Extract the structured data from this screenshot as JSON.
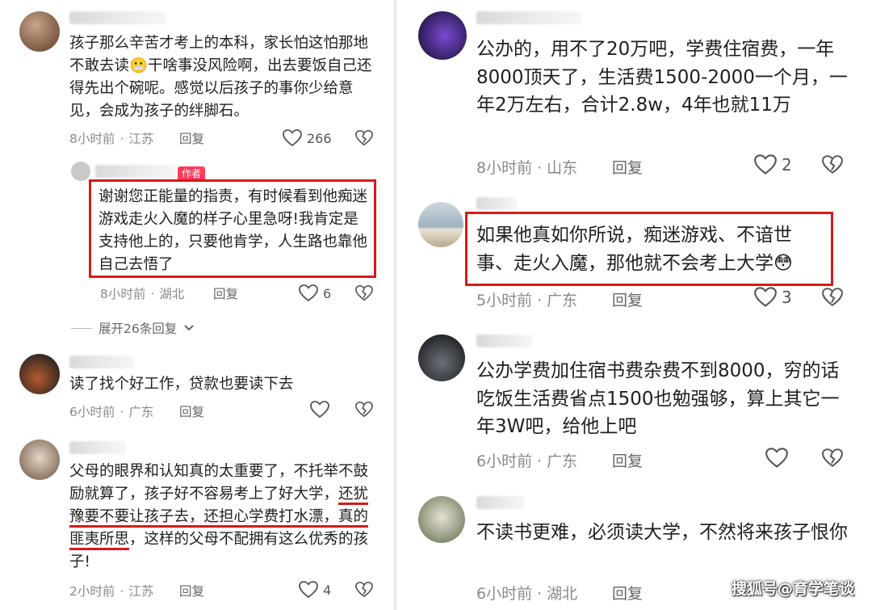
{
  "left": {
    "comments": [
      {
        "text": "孩子那么辛苦才考上的本科，家长怕这怕那地不敢去读😬干啥事没风险啊，出去要饭自己还得先出个碗呢。感觉以后孩子的事你少给意见，会成为孩子的绊脚石。",
        "time": "8小时前",
        "location": "江苏",
        "reply": "回复",
        "likes": "266"
      },
      {
        "author_tag": "作者",
        "text": "谢谢您正能量的指责，有时候看到他痴迷游戏走火入魔的样子心里急呀!我肯定是支持他上的，只要他肯学，人生路也靠他自己去悟了",
        "time": "8小时前",
        "location": "湖北",
        "reply": "回复",
        "likes": "6"
      },
      {
        "expand": "展开26条回复"
      },
      {
        "text": "读了找个好工作，贷款也要读下去",
        "time": "6小时前",
        "location": "广东",
        "reply": "回复",
        "likes": ""
      },
      {
        "text_parts": [
          "父母的眼界和认知真的太重要了，不托举不鼓励就算了，孩子好不容易考上了好大学，",
          "还犹豫要不要让孩子去，还担心学费打水漂，真的匪夷所思",
          "，这样的父母不配拥有这么优秀的孩子!"
        ],
        "time": "2小时前",
        "location": "江苏",
        "reply": "回复",
        "likes": "4"
      }
    ]
  },
  "right": {
    "comments": [
      {
        "text": "公办的，用不了20万吧，学费住宿费，一年8000顶天了，生活费1500-2000一个月，一年2万左右，合计2.8w，4年也就11万",
        "time": "8小时前",
        "location": "山东",
        "reply": "回复",
        "likes": "2"
      },
      {
        "text": "如果他真如你所说，痴迷游戏、不谙世事、走火入魔，那他就不会考上大学😳",
        "time": "5小时前",
        "location": "广东",
        "reply": "回复",
        "likes": "3"
      },
      {
        "text": "公办学费加住宿书费杂费不到8000，穷的话吃饭生活费省点1500也勉强够，算上其它一年3W吧，给他上吧",
        "time": "6小时前",
        "location": "广东",
        "reply": "回复",
        "likes": ""
      },
      {
        "text": "不读书更难，必须读大学，不然将来孩子恨你",
        "time": "6小时前",
        "location": "湖北",
        "reply": "回复",
        "likes": ""
      }
    ]
  },
  "watermark": "搜狐号@育学笔谈",
  "colors": {
    "highlight": "#d71a1a",
    "author_tag": "#ff3b5c",
    "meta": "#8a8a8a"
  },
  "icons": [
    "heart-icon",
    "dislike-heart-icon",
    "chevron-down-icon"
  ]
}
